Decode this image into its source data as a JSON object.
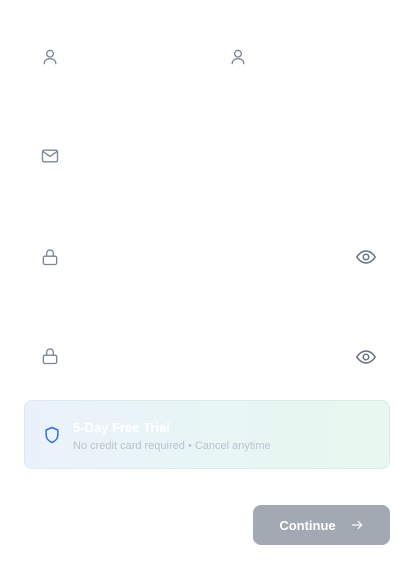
{
  "form": {
    "first_name": {
      "icon": "user-icon",
      "value": "",
      "placeholder": ""
    },
    "last_name": {
      "icon": "user-icon",
      "value": "",
      "placeholder": ""
    },
    "email": {
      "icon": "mail-icon",
      "value": "",
      "placeholder": ""
    },
    "password": {
      "icon": "lock-icon",
      "toggle_icon": "eye-icon",
      "value": "",
      "placeholder": ""
    },
    "confirm_password": {
      "icon": "lock-icon",
      "toggle_icon": "eye-icon",
      "value": "",
      "placeholder": ""
    }
  },
  "trial": {
    "icon": "shield-icon",
    "title": "5-Day Free Trial",
    "subtitle": "No credit card required • Cancel anytime"
  },
  "actions": {
    "continue_label": "Continue",
    "continue_icon": "arrow-right-icon",
    "continue_enabled": false
  },
  "colors": {
    "icon": "#7b8797",
    "eye": "#6b7685",
    "shield": "#2f6fe4",
    "button_disabled": "#a3a9b3"
  }
}
